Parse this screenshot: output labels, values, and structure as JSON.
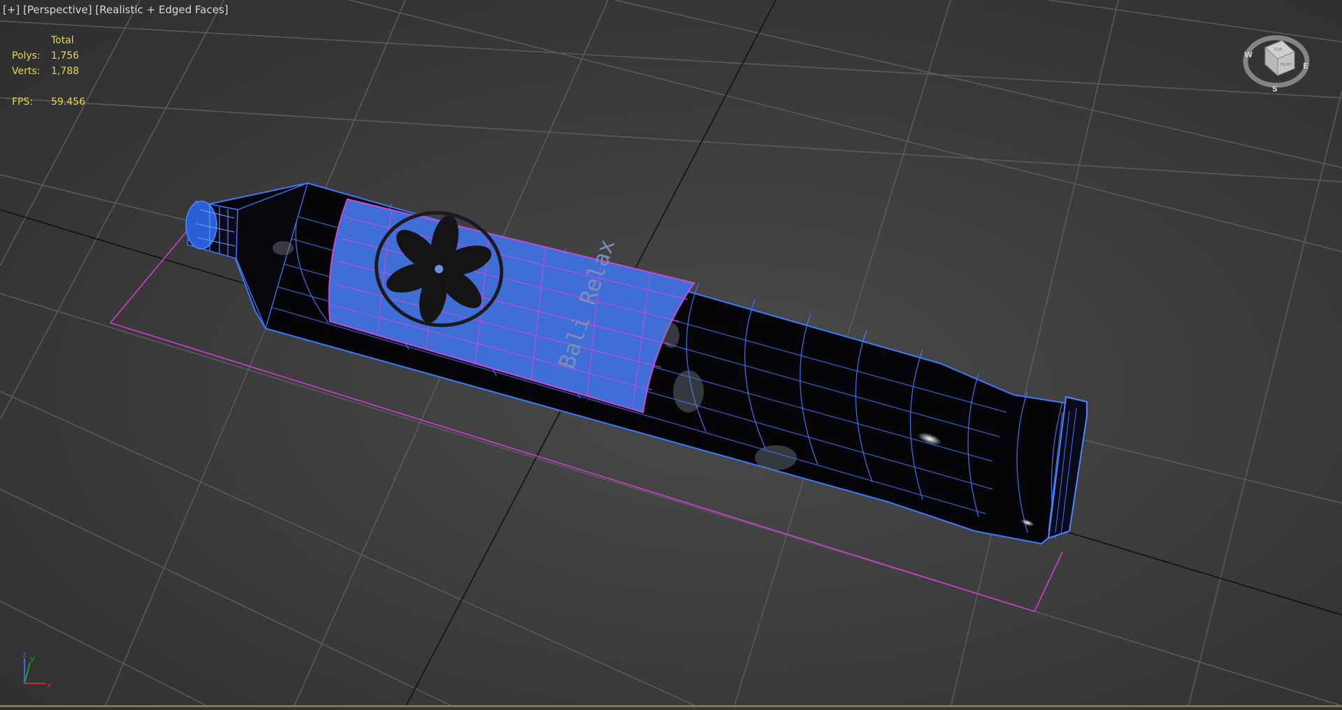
{
  "viewport": {
    "label_parts": [
      "[+]",
      "[Perspective]",
      "[Realistic + Edged Faces]"
    ]
  },
  "stats": {
    "header": "Total",
    "polys_label": "Polys:",
    "polys_value": "1,756",
    "verts_label": "Verts:",
    "verts_value": "1,788",
    "fps_label": "FPS:",
    "fps_value": "59.456"
  },
  "viewcube": {
    "face_top": "TOP",
    "face_front": "FRONT",
    "compass": [
      "W",
      "S",
      "E"
    ]
  },
  "axis_tripod": {
    "x": "x",
    "y": "y",
    "z": "z"
  },
  "model": {
    "label_text": "Bali Relax"
  },
  "colors": {
    "grid": "#5a5a5a",
    "grid_axis": "#111111",
    "wire": "#3a7bff",
    "selection": "#d23cd2",
    "label": "#4a7de0",
    "stat_text": "#e6d84a"
  }
}
